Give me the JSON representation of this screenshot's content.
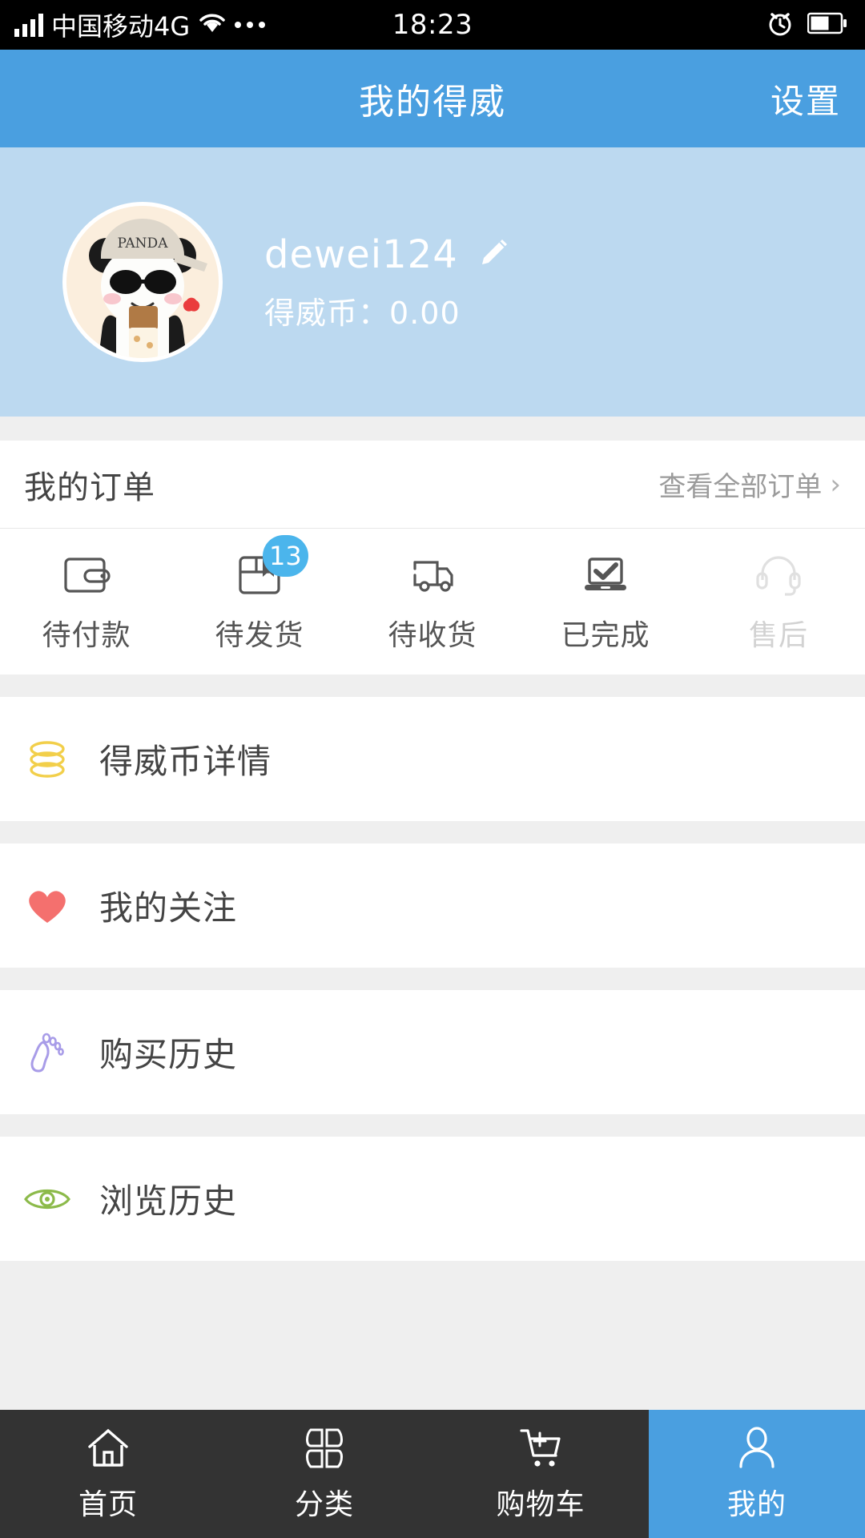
{
  "statusbar": {
    "signal_icon": "signal-bars-icon",
    "carrier": "中国移动4G",
    "wifi_icon": "wifi-icon",
    "more_icon": "more-dots-icon",
    "time": "18:23",
    "alarm_icon": "alarm-clock-icon",
    "battery_icon": "battery-icon"
  },
  "header": {
    "title": "我的得威",
    "settings_label": "设置",
    "background_color": "#4a9fe0"
  },
  "profile": {
    "avatar_name": "panda-avatar",
    "avatar_cap_text": "PANDA",
    "username": "dewei124",
    "edit_icon": "pencil-edit-icon",
    "coins_label": "得威币：",
    "coins_value": "0.00",
    "background_color": "#bcd9f0"
  },
  "orders": {
    "title": "我的订单",
    "view_all_label": "查看全部订单",
    "chevron": "›",
    "items": [
      {
        "label": "待付款",
        "icon": "wallet-icon",
        "badge": null,
        "disabled": false
      },
      {
        "label": "待发货",
        "icon": "package-box-icon",
        "badge": "13",
        "disabled": false
      },
      {
        "label": "待收货",
        "icon": "delivery-truck-icon",
        "badge": null,
        "disabled": false
      },
      {
        "label": "已完成",
        "icon": "laptop-check-icon",
        "badge": null,
        "disabled": false
      },
      {
        "label": "售后",
        "icon": "headset-icon",
        "badge": null,
        "disabled": true
      }
    ],
    "badge_color": "#4bb5ec"
  },
  "menu": [
    {
      "label": "得威币详情",
      "icon": "coin-stack-icon",
      "color": "#f2cf4a"
    },
    {
      "label": "我的关注",
      "icon": "heart-icon",
      "color": "#f4706e"
    },
    {
      "label": "购买历史",
      "icon": "footprint-icon",
      "color": "#a89ce8"
    },
    {
      "label": "浏览历史",
      "icon": "eye-icon",
      "color": "#8cba4a"
    }
  ],
  "tabbar": {
    "background_color": "#333333",
    "active_color": "#4a9fe0",
    "tabs": [
      {
        "label": "首页",
        "icon": "home-icon",
        "active": false
      },
      {
        "label": "分类",
        "icon": "category-grid-icon",
        "active": false
      },
      {
        "label": "购物车",
        "icon": "shopping-cart-icon",
        "active": false
      },
      {
        "label": "我的",
        "icon": "person-icon",
        "active": true
      }
    ]
  }
}
